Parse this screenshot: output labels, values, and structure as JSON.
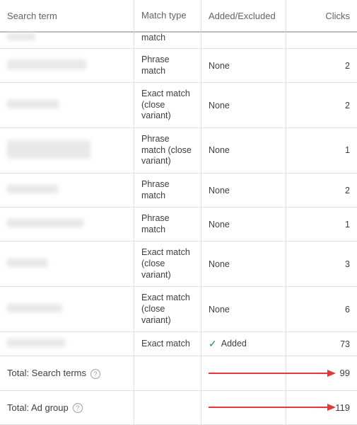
{
  "columns": {
    "term": "Search term",
    "match": "Match type",
    "added": "Added/Excluded",
    "clicks": "Clicks"
  },
  "partial_row": {
    "match": "match"
  },
  "rows": [
    {
      "match": "Phrase match",
      "added": "None",
      "clicks": 2,
      "blur_w": 112,
      "blur_h": 14
    },
    {
      "match": "Exact match (close variant)",
      "added": "None",
      "clicks": 2,
      "blur_w": 74,
      "blur_h": 12
    },
    {
      "match": "Phrase match (close variant)",
      "added": "None",
      "clicks": 1,
      "blur_w": 118,
      "blur_h": 26
    },
    {
      "match": "Phrase match",
      "added": "None",
      "clicks": 2,
      "blur_w": 72,
      "blur_h": 12
    },
    {
      "match": "Phrase match",
      "added": "None",
      "clicks": 1,
      "blur_w": 108,
      "blur_h": 12
    },
    {
      "match": "Exact match (close variant)",
      "added": "None",
      "clicks": 3,
      "blur_w": 58,
      "blur_h": 12
    },
    {
      "match": "Exact match (close variant)",
      "added": "None",
      "clicks": 6,
      "blur_w": 78,
      "blur_h": 12
    },
    {
      "match": "Exact match",
      "added": "Added",
      "clicks": 73,
      "blur_w": 82,
      "blur_h": 12,
      "added_check": true
    }
  ],
  "totals": [
    {
      "label": "Total: Search terms",
      "clicks": 99
    },
    {
      "label": "Total: Ad group",
      "clicks": 119
    }
  ]
}
